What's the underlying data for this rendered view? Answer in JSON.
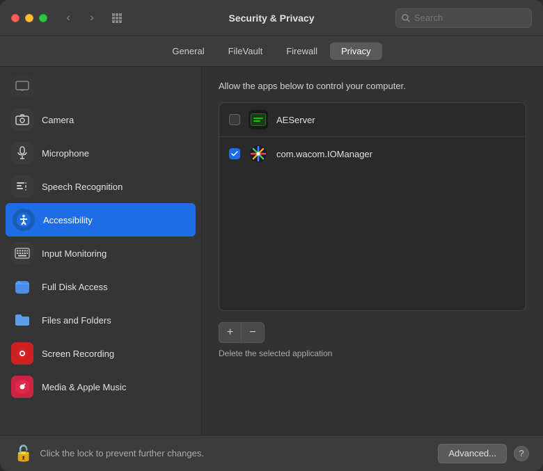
{
  "window": {
    "title": "Security & Privacy",
    "search_placeholder": "Search"
  },
  "titlebar": {
    "back_label": "‹",
    "forward_label": "›",
    "grid_label": "⊞"
  },
  "tabs": [
    {
      "id": "general",
      "label": "General",
      "active": false
    },
    {
      "id": "filevault",
      "label": "FileVault",
      "active": false
    },
    {
      "id": "firewall",
      "label": "Firewall",
      "active": false
    },
    {
      "id": "privacy",
      "label": "Privacy",
      "active": true
    }
  ],
  "sidebar": {
    "items": [
      {
        "id": "camera",
        "label": "Camera",
        "icon": "camera",
        "active": false
      },
      {
        "id": "microphone",
        "label": "Microphone",
        "icon": "microphone",
        "active": false
      },
      {
        "id": "speech-recognition",
        "label": "Speech Recognition",
        "icon": "speech",
        "active": false
      },
      {
        "id": "accessibility",
        "label": "Accessibility",
        "icon": "accessibility",
        "active": true
      },
      {
        "id": "input-monitoring",
        "label": "Input Monitoring",
        "icon": "keyboard",
        "active": false
      },
      {
        "id": "full-disk-access",
        "label": "Full Disk Access",
        "icon": "folder-blue",
        "active": false
      },
      {
        "id": "files-and-folders",
        "label": "Files and Folders",
        "icon": "folder-blue2",
        "active": false
      },
      {
        "id": "screen-recording",
        "label": "Screen Recording",
        "icon": "screen-record",
        "active": false
      },
      {
        "id": "media-apple-music",
        "label": "Media & Apple Music",
        "icon": "music",
        "active": false
      }
    ]
  },
  "main": {
    "description": "Allow the apps below to control your computer.",
    "apps": [
      {
        "id": "aeserver",
        "name": "AEServer",
        "checked": false
      },
      {
        "id": "wacom",
        "name": "com.wacom.IOManager",
        "checked": true
      }
    ],
    "add_label": "+",
    "remove_label": "−",
    "delete_hint": "Delete the selected application"
  },
  "bottom": {
    "lock_text": "Click the lock to prevent further changes.",
    "advanced_label": "Advanced...",
    "help_label": "?"
  }
}
